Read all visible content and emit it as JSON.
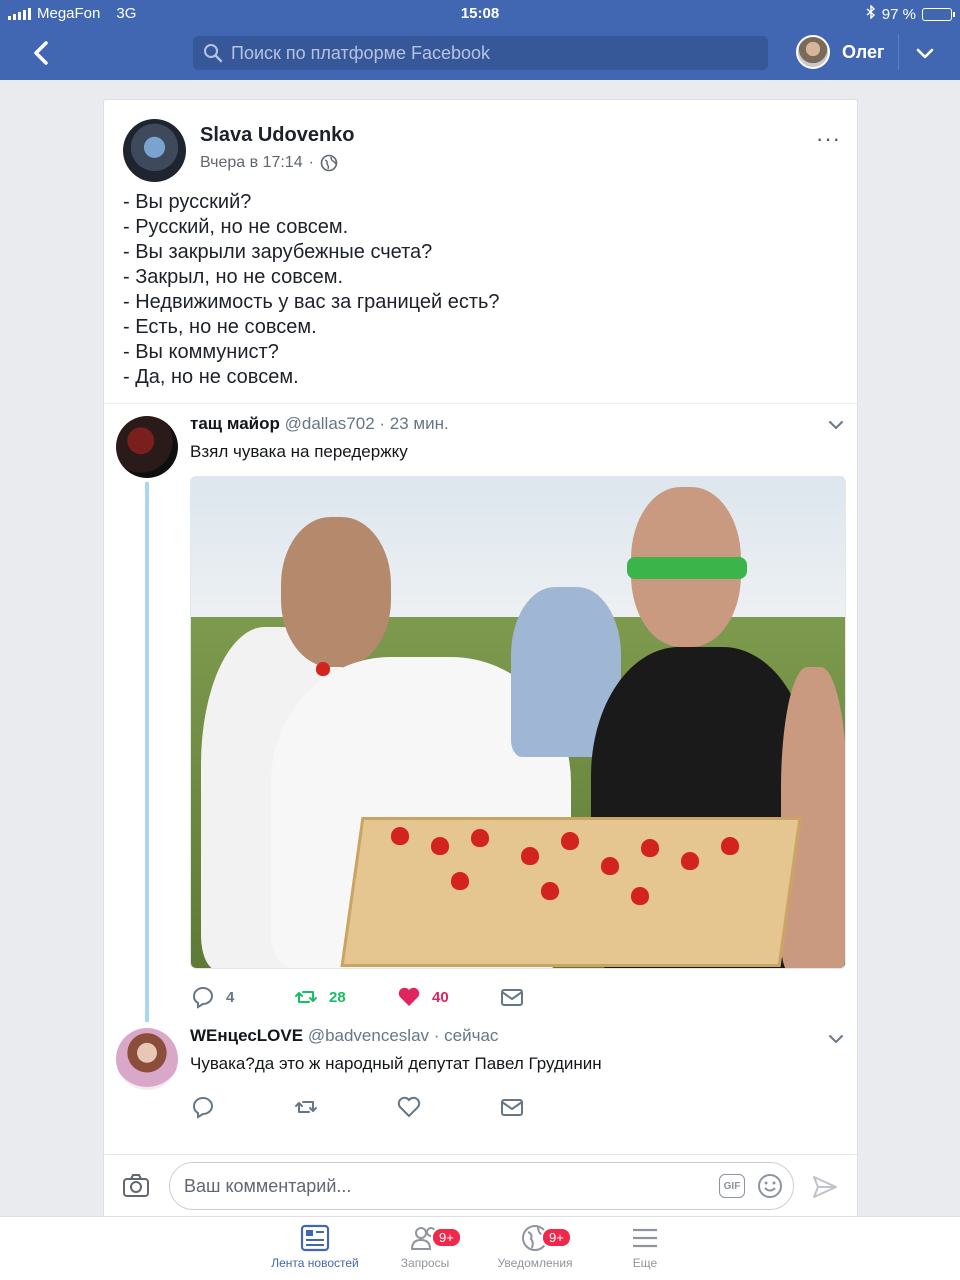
{
  "status_bar": {
    "carrier": "MegaFon",
    "network": "3G",
    "time": "15:08",
    "battery": "97 %",
    "battery_level": 0.97
  },
  "nav": {
    "search_placeholder": "Поиск по платформе Facebook",
    "user_name": "Олег"
  },
  "post": {
    "author": "Slava Udovenko",
    "timestamp": "Вчера в 17:14",
    "separator": "·",
    "more_label": "···",
    "lines": [
      "- Вы русский?",
      "- Русский, но не совсем.",
      "- Вы закрыли зарубежные счета?",
      "- Закрыл, но не совсем.",
      "- Недвижимость у вас за границей есть?",
      "- Есть, но не совсем.",
      "- Вы коммунист?",
      "- Да, но не совсем."
    ]
  },
  "tweet1": {
    "name": "тащ майор",
    "handle": "@dallas702",
    "time": "· 23 мин.",
    "text": "Взял чувака на передержку",
    "replies": "4",
    "retweets": "28",
    "likes": "40"
  },
  "tweet2": {
    "name": "WEнцесLOVE",
    "handle": "@badvenceslav",
    "time": "· сейчас",
    "text": "Чувака?да это ж народный депутат Павел Грудинин"
  },
  "comment": {
    "placeholder": "Ваш комментарий...",
    "gif_label": "GIF"
  },
  "tabs": [
    {
      "label": "Лента новостей",
      "badge": ""
    },
    {
      "label": "Запросы",
      "badge": "9+"
    },
    {
      "label": "Уведомления",
      "badge": "9+"
    },
    {
      "label": "Еще",
      "badge": ""
    }
  ],
  "colors": {
    "fb_blue": "#4267b2",
    "twitter_green": "#17bf63",
    "twitter_red": "#e0245e",
    "badge_red": "#f02849"
  }
}
